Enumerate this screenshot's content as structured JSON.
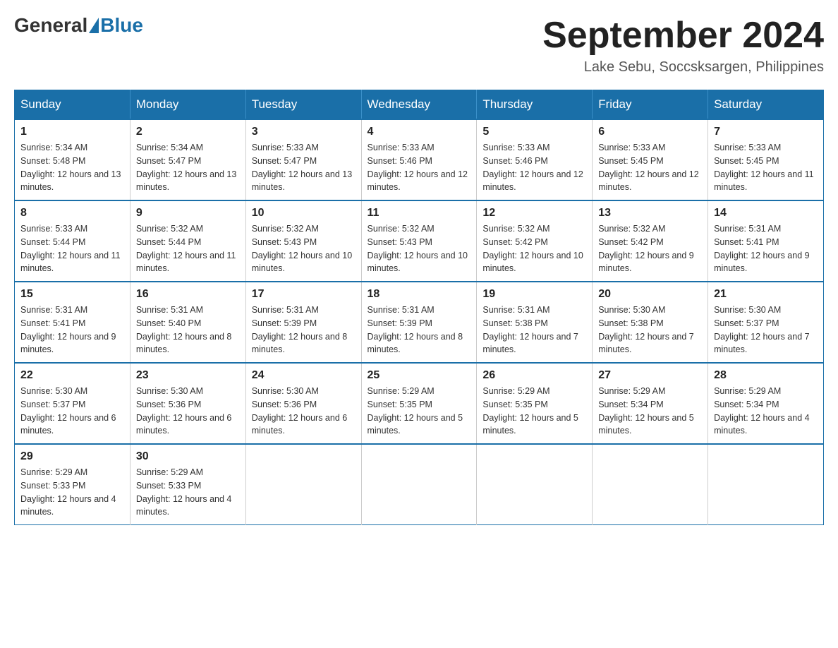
{
  "logo": {
    "general": "General",
    "blue": "Blue"
  },
  "title": "September 2024",
  "subtitle": "Lake Sebu, Soccsksargen, Philippines",
  "days_of_week": [
    "Sunday",
    "Monday",
    "Tuesday",
    "Wednesday",
    "Thursday",
    "Friday",
    "Saturday"
  ],
  "weeks": [
    [
      {
        "day": "1",
        "sunrise": "5:34 AM",
        "sunset": "5:48 PM",
        "daylight": "12 hours and 13 minutes."
      },
      {
        "day": "2",
        "sunrise": "5:34 AM",
        "sunset": "5:47 PM",
        "daylight": "12 hours and 13 minutes."
      },
      {
        "day": "3",
        "sunrise": "5:33 AM",
        "sunset": "5:47 PM",
        "daylight": "12 hours and 13 minutes."
      },
      {
        "day": "4",
        "sunrise": "5:33 AM",
        "sunset": "5:46 PM",
        "daylight": "12 hours and 12 minutes."
      },
      {
        "day": "5",
        "sunrise": "5:33 AM",
        "sunset": "5:46 PM",
        "daylight": "12 hours and 12 minutes."
      },
      {
        "day": "6",
        "sunrise": "5:33 AM",
        "sunset": "5:45 PM",
        "daylight": "12 hours and 12 minutes."
      },
      {
        "day": "7",
        "sunrise": "5:33 AM",
        "sunset": "5:45 PM",
        "daylight": "12 hours and 11 minutes."
      }
    ],
    [
      {
        "day": "8",
        "sunrise": "5:33 AM",
        "sunset": "5:44 PM",
        "daylight": "12 hours and 11 minutes."
      },
      {
        "day": "9",
        "sunrise": "5:32 AM",
        "sunset": "5:44 PM",
        "daylight": "12 hours and 11 minutes."
      },
      {
        "day": "10",
        "sunrise": "5:32 AM",
        "sunset": "5:43 PM",
        "daylight": "12 hours and 10 minutes."
      },
      {
        "day": "11",
        "sunrise": "5:32 AM",
        "sunset": "5:43 PM",
        "daylight": "12 hours and 10 minutes."
      },
      {
        "day": "12",
        "sunrise": "5:32 AM",
        "sunset": "5:42 PM",
        "daylight": "12 hours and 10 minutes."
      },
      {
        "day": "13",
        "sunrise": "5:32 AM",
        "sunset": "5:42 PM",
        "daylight": "12 hours and 9 minutes."
      },
      {
        "day": "14",
        "sunrise": "5:31 AM",
        "sunset": "5:41 PM",
        "daylight": "12 hours and 9 minutes."
      }
    ],
    [
      {
        "day": "15",
        "sunrise": "5:31 AM",
        "sunset": "5:41 PM",
        "daylight": "12 hours and 9 minutes."
      },
      {
        "day": "16",
        "sunrise": "5:31 AM",
        "sunset": "5:40 PM",
        "daylight": "12 hours and 8 minutes."
      },
      {
        "day": "17",
        "sunrise": "5:31 AM",
        "sunset": "5:39 PM",
        "daylight": "12 hours and 8 minutes."
      },
      {
        "day": "18",
        "sunrise": "5:31 AM",
        "sunset": "5:39 PM",
        "daylight": "12 hours and 8 minutes."
      },
      {
        "day": "19",
        "sunrise": "5:31 AM",
        "sunset": "5:38 PM",
        "daylight": "12 hours and 7 minutes."
      },
      {
        "day": "20",
        "sunrise": "5:30 AM",
        "sunset": "5:38 PM",
        "daylight": "12 hours and 7 minutes."
      },
      {
        "day": "21",
        "sunrise": "5:30 AM",
        "sunset": "5:37 PM",
        "daylight": "12 hours and 7 minutes."
      }
    ],
    [
      {
        "day": "22",
        "sunrise": "5:30 AM",
        "sunset": "5:37 PM",
        "daylight": "12 hours and 6 minutes."
      },
      {
        "day": "23",
        "sunrise": "5:30 AM",
        "sunset": "5:36 PM",
        "daylight": "12 hours and 6 minutes."
      },
      {
        "day": "24",
        "sunrise": "5:30 AM",
        "sunset": "5:36 PM",
        "daylight": "12 hours and 6 minutes."
      },
      {
        "day": "25",
        "sunrise": "5:29 AM",
        "sunset": "5:35 PM",
        "daylight": "12 hours and 5 minutes."
      },
      {
        "day": "26",
        "sunrise": "5:29 AM",
        "sunset": "5:35 PM",
        "daylight": "12 hours and 5 minutes."
      },
      {
        "day": "27",
        "sunrise": "5:29 AM",
        "sunset": "5:34 PM",
        "daylight": "12 hours and 5 minutes."
      },
      {
        "day": "28",
        "sunrise": "5:29 AM",
        "sunset": "5:34 PM",
        "daylight": "12 hours and 4 minutes."
      }
    ],
    [
      {
        "day": "29",
        "sunrise": "5:29 AM",
        "sunset": "5:33 PM",
        "daylight": "12 hours and 4 minutes."
      },
      {
        "day": "30",
        "sunrise": "5:29 AM",
        "sunset": "5:33 PM",
        "daylight": "12 hours and 4 minutes."
      },
      null,
      null,
      null,
      null,
      null
    ]
  ]
}
